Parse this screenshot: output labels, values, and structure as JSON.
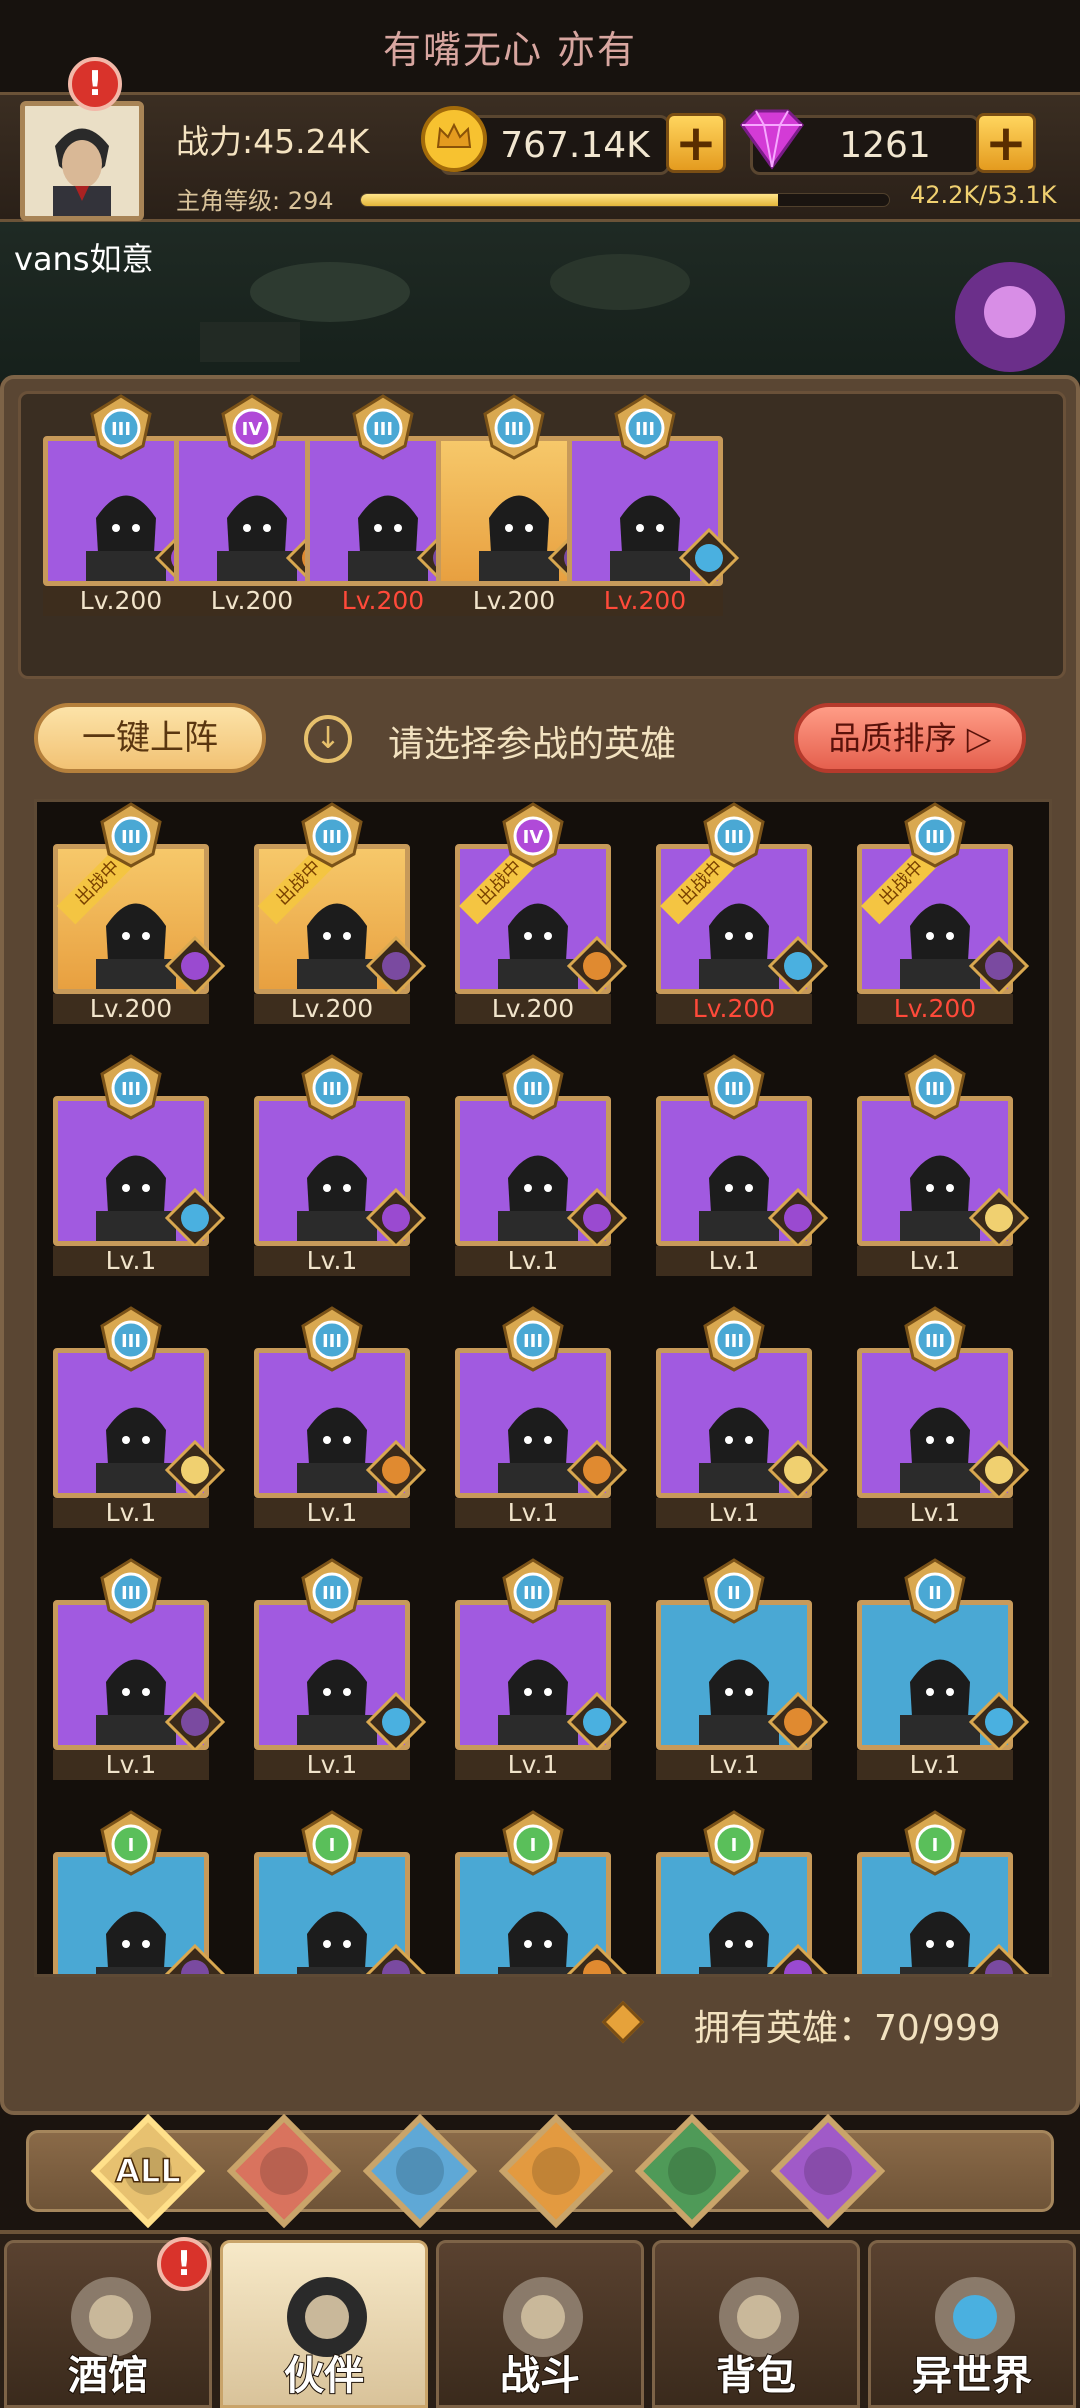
{
  "ticker": {
    "text": "有嘴无心 亦有"
  },
  "header": {
    "power": "战力:45.24K",
    "level_label": "主角等级:",
    "level": "294",
    "xp": "42.2K/53.1K",
    "xp_progress": 0.79,
    "gold": "767.14K",
    "gems": "1261"
  },
  "player": {
    "name": "vans如意"
  },
  "team": {
    "slots": [
      {
        "level": "Lv.200",
        "rank": "III",
        "bg": "purple",
        "faction": "demon-icon",
        "red": false
      },
      {
        "level": "Lv.200",
        "rank": "IV",
        "bg": "purple",
        "faction": "lion-icon",
        "red": false
      },
      {
        "level": "Lv.200",
        "rank": "III",
        "bg": "purple",
        "faction": "knight-icon",
        "red": true
      },
      {
        "level": "Lv.200",
        "rank": "III",
        "bg": "gold",
        "faction": "knight-icon",
        "red": false
      },
      {
        "level": "Lv.200",
        "rank": "III",
        "bg": "purple",
        "faction": "fairy-icon",
        "red": true
      }
    ]
  },
  "actions": {
    "auto_deploy": "一键上阵",
    "hint": "请选择参战的英雄",
    "sort": "品质排序"
  },
  "roster": {
    "deployed_label": "出战中",
    "heroes": [
      {
        "level": "Lv.200",
        "rank": "III",
        "bg": "gold",
        "faction": "demon-icon",
        "deployed": true,
        "red": false
      },
      {
        "level": "Lv.200",
        "rank": "III",
        "bg": "gold",
        "faction": "knight-icon",
        "deployed": true,
        "red": false
      },
      {
        "level": "Lv.200",
        "rank": "IV",
        "bg": "purple",
        "faction": "lion-icon",
        "deployed": true,
        "red": false
      },
      {
        "level": "Lv.200",
        "rank": "III",
        "bg": "purple",
        "faction": "fairy-icon",
        "deployed": true,
        "red": true
      },
      {
        "level": "Lv.200",
        "rank": "III",
        "bg": "purple",
        "faction": "knight-icon",
        "deployed": true,
        "red": true
      },
      {
        "level": "Lv.1",
        "rank": "III",
        "bg": "purple",
        "faction": "fairy-icon"
      },
      {
        "level": "Lv.1",
        "rank": "III",
        "bg": "purple",
        "faction": "demon-icon"
      },
      {
        "level": "Lv.1",
        "rank": "III",
        "bg": "purple",
        "faction": "demon-icon"
      },
      {
        "level": "Lv.1",
        "rank": "III",
        "bg": "purple",
        "faction": "demon-icon"
      },
      {
        "level": "Lv.1",
        "rank": "III",
        "bg": "purple",
        "faction": "elf-icon"
      },
      {
        "level": "Lv.1",
        "rank": "III",
        "bg": "purple",
        "faction": "elf-icon"
      },
      {
        "level": "Lv.1",
        "rank": "III",
        "bg": "purple",
        "faction": "lion-icon"
      },
      {
        "level": "Lv.1",
        "rank": "III",
        "bg": "purple",
        "faction": "lion-icon"
      },
      {
        "level": "Lv.1",
        "rank": "III",
        "bg": "purple",
        "faction": "elf-icon"
      },
      {
        "level": "Lv.1",
        "rank": "III",
        "bg": "purple",
        "faction": "elf-icon"
      },
      {
        "level": "Lv.1",
        "rank": "III",
        "bg": "purple",
        "faction": "knight-icon"
      },
      {
        "level": "Lv.1",
        "rank": "III",
        "bg": "purple",
        "faction": "fairy-icon"
      },
      {
        "level": "Lv.1",
        "rank": "III",
        "bg": "purple",
        "faction": "fairy-icon"
      },
      {
        "level": "Lv.1",
        "rank": "II",
        "bg": "blue",
        "faction": "lion-icon"
      },
      {
        "level": "Lv.1",
        "rank": "II",
        "bg": "blue",
        "faction": "fairy-icon"
      },
      {
        "level": "",
        "rank": "I",
        "bg": "blue",
        "faction": "knight-icon"
      },
      {
        "level": "",
        "rank": "I",
        "bg": "blue",
        "faction": "knight-icon"
      },
      {
        "level": "",
        "rank": "I",
        "bg": "blue",
        "faction": "lion-icon"
      },
      {
        "level": "",
        "rank": "I",
        "bg": "blue",
        "faction": "demon-icon"
      },
      {
        "level": "",
        "rank": "I",
        "bg": "blue",
        "faction": "knight-icon"
      }
    ]
  },
  "owned": {
    "label": "拥有英雄：70/999"
  },
  "filters": [
    {
      "label": "ALL",
      "icon": "all-icon",
      "color": "#e7c170"
    },
    {
      "label": "",
      "icon": "knight-icon",
      "color": "#d9735e"
    },
    {
      "label": "",
      "icon": "fairy-icon",
      "color": "#5fa8d6"
    },
    {
      "label": "",
      "icon": "lion-icon",
      "color": "#e39a40"
    },
    {
      "label": "",
      "icon": "elf-icon",
      "color": "#4f9a58"
    },
    {
      "label": "",
      "icon": "demon-icon",
      "color": "#a05ac8"
    }
  ],
  "nav": {
    "tabs": [
      {
        "label": "酒馆",
        "icon": "beer-mug-icon",
        "alert": "!"
      },
      {
        "label": "伙伴",
        "icon": "companion-icon"
      },
      {
        "label": "战斗",
        "icon": "crossed-swords-icon"
      },
      {
        "label": "背包",
        "icon": "backpack-icon"
      },
      {
        "label": "异世界",
        "icon": "portal-icon"
      }
    ]
  },
  "colors": {
    "purple": "#a15ae0",
    "gold": "#f0b355",
    "blue": "#4aa8d4",
    "red_level": "#ff4a3a"
  }
}
